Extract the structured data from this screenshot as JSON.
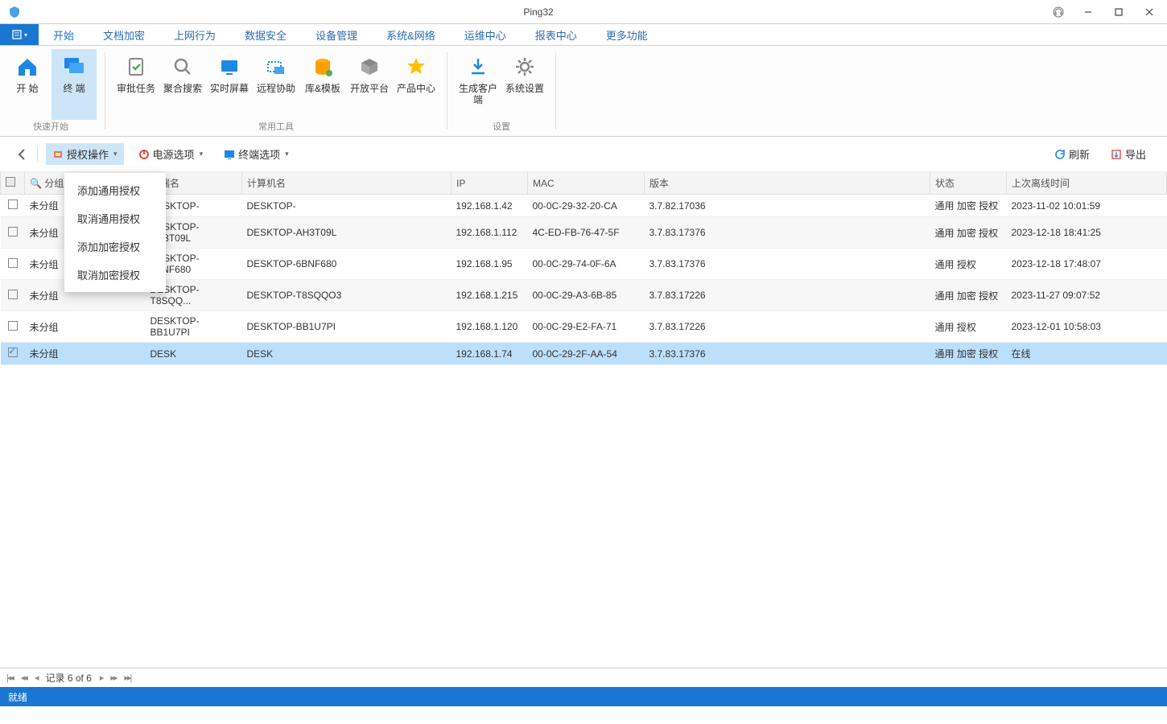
{
  "window": {
    "title": "Ping32"
  },
  "tabs": {
    "start": "开始",
    "doc_encrypt": "文档加密",
    "net_behavior": "上网行为",
    "data_security": "数据安全",
    "device_mgmt": "设备管理",
    "sys_net": "系统&网络",
    "ops_center": "运维中心",
    "report_center": "报表中心",
    "more": "更多功能"
  },
  "ribbon": {
    "groups": {
      "quick_start": "快速开始",
      "common_tools": "常用工具",
      "settings": "设置"
    },
    "buttons": {
      "home": "开 始",
      "terminal": "终 端",
      "approval": "审批任务",
      "search": "聚合搜索",
      "realtime": "实时屏幕",
      "remote": "远程协助",
      "library": "库&模板",
      "open_platform": "开放平台",
      "product_center": "产品中心",
      "gen_client": "生成客户端",
      "sys_settings": "系统设置"
    }
  },
  "toolbar": {
    "auth_ops": "授权操作",
    "power_opts": "电源选项",
    "terminal_opts": "终端选项",
    "refresh": "刷新",
    "export": "导出"
  },
  "dropdown": {
    "add_general_auth": "添加通用授权",
    "cancel_general_auth": "取消通用授权",
    "add_encrypt_auth": "添加加密授权",
    "cancel_encrypt_auth": "取消加密授权"
  },
  "table": {
    "headers": {
      "group": "分组",
      "terminal_name": "终端名",
      "computer_name": "计算机名",
      "ip": "IP",
      "mac": "MAC",
      "version": "版本",
      "status": "状态",
      "last_offline": "上次离线时间"
    },
    "rows": [
      {
        "checked": false,
        "group": "未分组",
        "tname": "DESKTOP-",
        "cname": "DESKTOP-",
        "ip": "192.168.1.42",
        "mac": "00-0C-29-32-20-CA",
        "ver": "3.7.82.17036",
        "status": "通用 加密 授权",
        "offline": "2023-11-02 10:01:59"
      },
      {
        "checked": false,
        "group": "未分组",
        "tname": "DESKTOP-AH3T09L",
        "cname": "DESKTOP-AH3T09L",
        "ip": "192.168.1.112",
        "mac": "4C-ED-FB-76-47-5F",
        "ver": "3.7.83.17376",
        "status": "通用 加密 授权",
        "offline": "2023-12-18 18:41:25"
      },
      {
        "checked": false,
        "group": "未分组",
        "tname": "DESKTOP-6BNF680",
        "cname": "DESKTOP-6BNF680",
        "ip": "192.168.1.95",
        "mac": "00-0C-29-74-0F-6A",
        "ver": "3.7.83.17376",
        "status": "通用 授权",
        "offline": "2023-12-18 17:48:07"
      },
      {
        "checked": false,
        "group": "未分组",
        "tname": "DESKTOP-T8SQQ...",
        "cname": "DESKTOP-T8SQQO3",
        "ip": "192.168.1.215",
        "mac": "00-0C-29-A3-6B-85",
        "ver": "3.7.83.17226",
        "status": "通用 加密 授权",
        "offline": "2023-11-27 09:07:52"
      },
      {
        "checked": false,
        "group": "未分组",
        "tname": "DESKTOP-BB1U7PI",
        "cname": "DESKTOP-BB1U7PI",
        "ip": "192.168.1.120",
        "mac": "00-0C-29-E2-FA-71",
        "ver": "3.7.83.17226",
        "status": "通用 授权",
        "offline": "2023-12-01 10:58:03"
      },
      {
        "checked": true,
        "group": "未分组",
        "tname": "DESK",
        "cname": "DESK",
        "ip": "192.168.1.74",
        "mac": "00-0C-29-2F-AA-54",
        "ver": "3.7.83.17376",
        "status": "通用 加密 授权",
        "offline": "在线"
      }
    ]
  },
  "pager": {
    "label": "记录 6 of 6"
  },
  "statusbar": {
    "text": "就绪"
  },
  "colors": {
    "accent": "#1976d2",
    "select_row": "#bcdffb",
    "ribbon_active": "#cde6f7"
  }
}
